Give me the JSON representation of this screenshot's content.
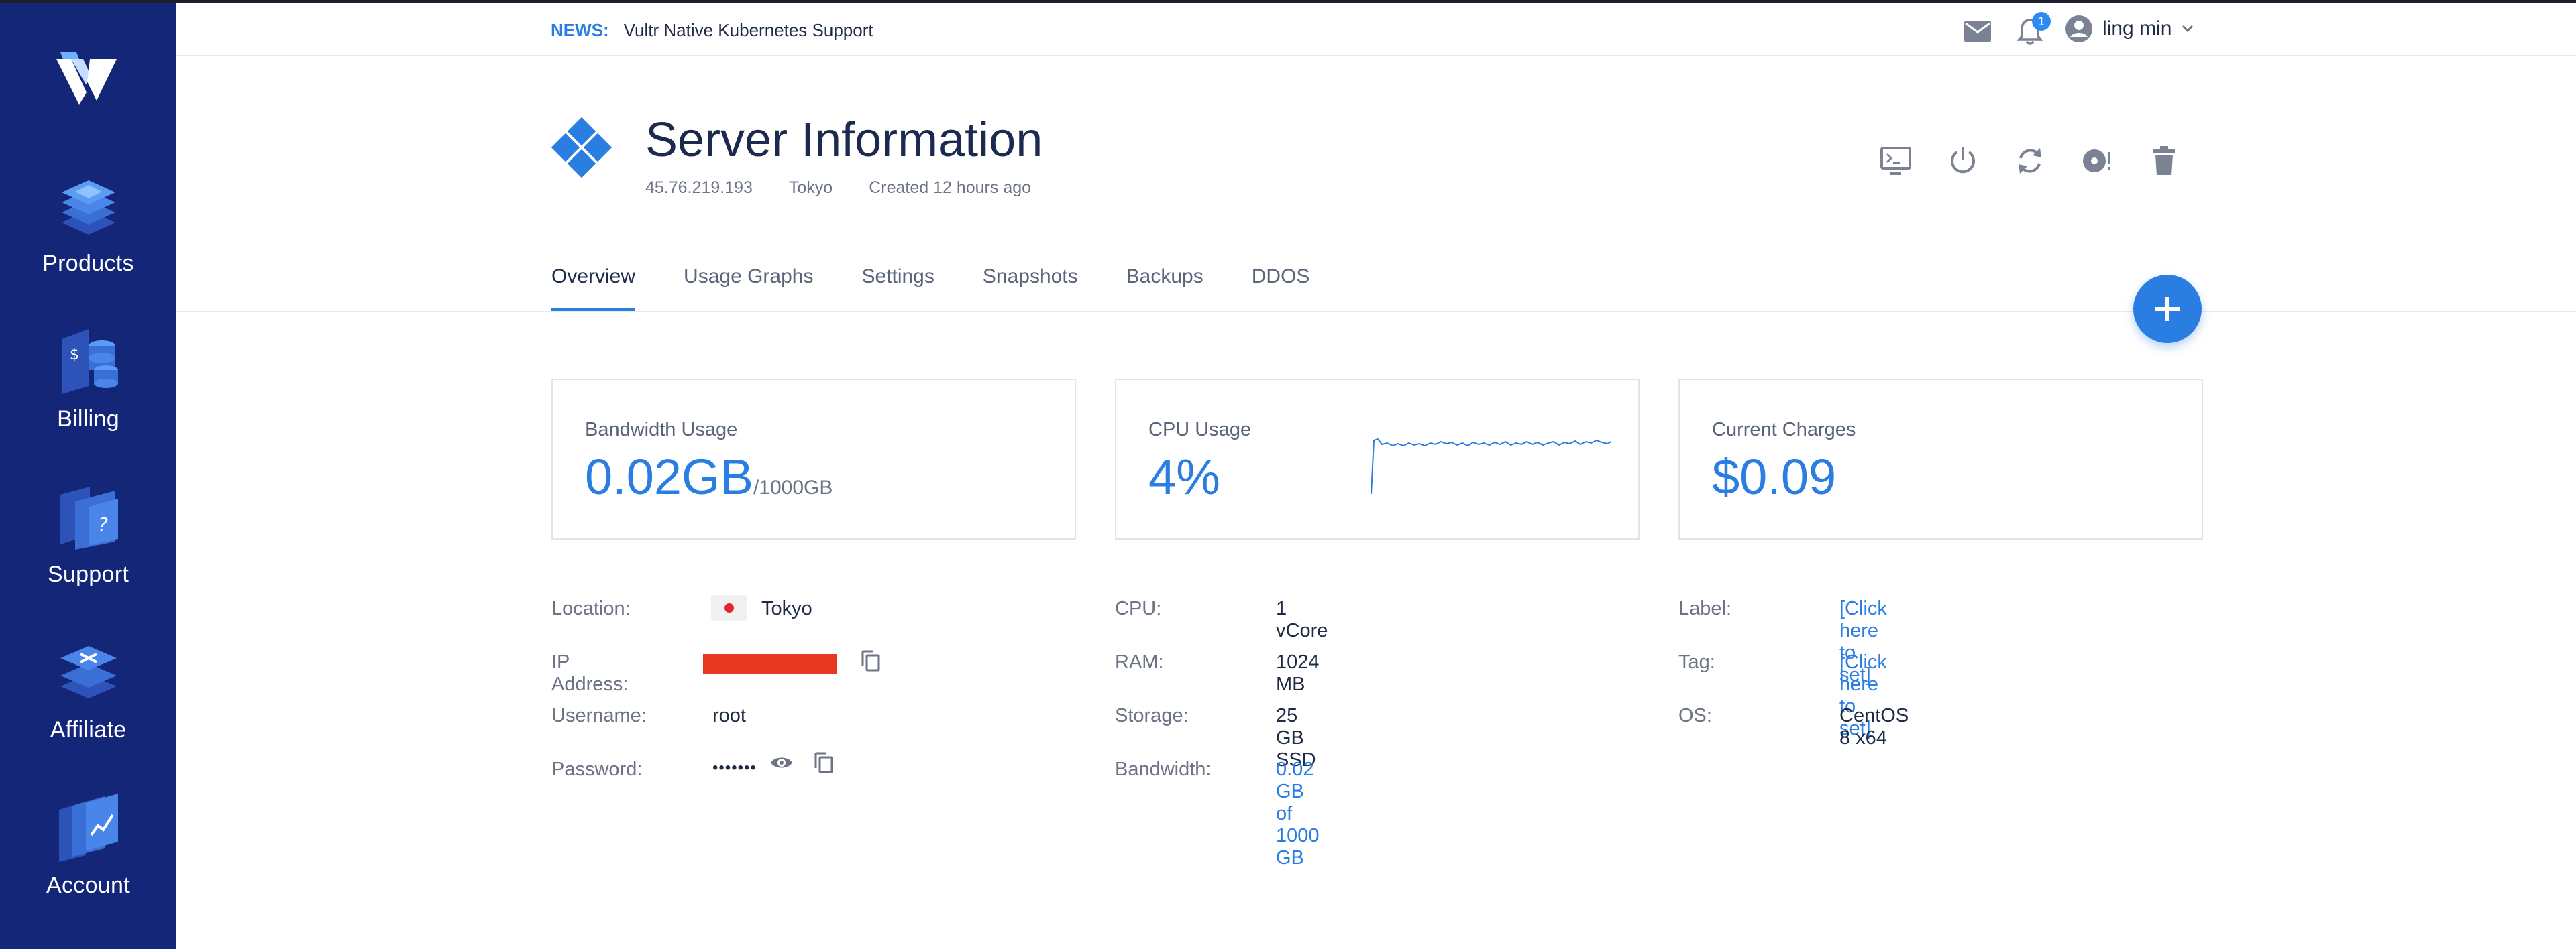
{
  "sidebar": {
    "items": [
      {
        "label": "Products",
        "icon": "products-icon"
      },
      {
        "label": "Billing",
        "icon": "billing-icon"
      },
      {
        "label": "Support",
        "icon": "support-icon"
      },
      {
        "label": "Affiliate",
        "icon": "affiliate-icon"
      },
      {
        "label": "Account",
        "icon": "account-icon"
      }
    ]
  },
  "header": {
    "news_label": "NEWS:",
    "news_text": "Vultr Native Kubernetes Support",
    "notification_count": "1",
    "user_name": "ling min"
  },
  "server": {
    "title": "Server Information",
    "ip": "45.76.219.193",
    "location": "Tokyo",
    "created": "Created 12 hours ago"
  },
  "tabs": [
    "Overview",
    "Usage Graphs",
    "Settings",
    "Snapshots",
    "Backups",
    "DDOS"
  ],
  "cards": {
    "bandwidth": {
      "label": "Bandwidth Usage",
      "value": "0.02GB",
      "sub": "/1000GB"
    },
    "cpu": {
      "label": "CPU Usage",
      "value": "4%"
    },
    "charges": {
      "label": "Current Charges",
      "value": "$0.09"
    }
  },
  "details": {
    "location_label": "Location:",
    "location_value": "Tokyo",
    "ip_label": "IP Address:",
    "username_label": "Username:",
    "username_value": "root",
    "password_label": "Password:",
    "password_value": "•••••••",
    "cpu_label": "CPU:",
    "cpu_value": "1 vCore",
    "ram_label": "RAM:",
    "ram_value": "1024 MB",
    "storage_label": "Storage:",
    "storage_value": "25 GB SSD",
    "bandwidth_label": "Bandwidth:",
    "bandwidth_value": "0.02 GB of 1000 GB",
    "label_label": "Label:",
    "label_value": "[Click here to set]",
    "tag_label": "Tag:",
    "tag_value": "[Click here to set]",
    "os_label": "OS:",
    "os_value": "CentOS 8 x64"
  },
  "colors": {
    "sidebar": "#142678",
    "accent": "#2a7de1",
    "redacted": "#e8371f"
  }
}
